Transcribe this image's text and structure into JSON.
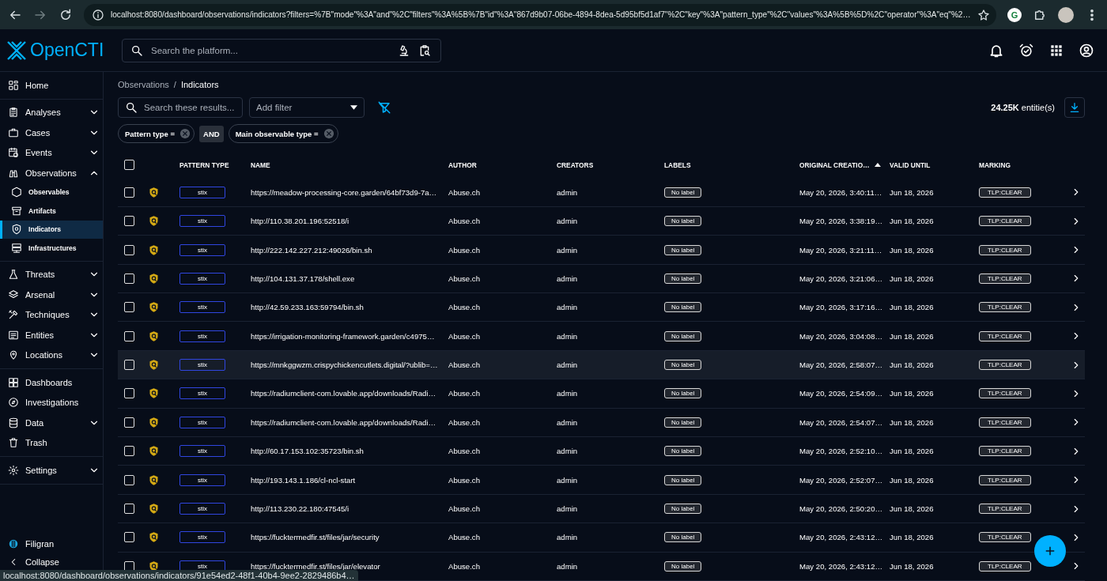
{
  "browser": {
    "url": "localhost:8080/dashboard/observations/indicators?filters=%7B\"mode\"%3A\"and\"%2C\"filters\"%3A%5B%7B\"id\"%3A\"867d9b07-06be-4894-8dea-5d95bf5d1af7\"%2C\"key\"%3A\"pattern_type\"%2C\"values\"%3A%5B%5D%2C\"operator\"%3A\"eq\"%2…",
    "extension_letter": "G",
    "status_url": "localhost:8080/dashboard/observations/indicators/91e54ed2-48f1-40b4-9ee2-2829486b4…"
  },
  "header": {
    "logo": "OpenCTI",
    "search": {
      "placeholder": "Search the platform..."
    }
  },
  "sidebar": {
    "groups": [
      [
        {
          "label": "Home",
          "selected": false
        }
      ],
      [
        {
          "label": "Analyses",
          "selected": false,
          "expanded": false
        },
        {
          "label": "Cases",
          "selected": false,
          "expanded": false
        },
        {
          "label": "Events",
          "selected": false,
          "expanded": false
        },
        {
          "label": "Observations",
          "selected": false,
          "expanded": true,
          "children": [
            {
              "label": "Observables",
              "selected": false
            },
            {
              "label": "Artifacts",
              "selected": false
            },
            {
              "label": "Indicators",
              "selected": true
            },
            {
              "label": "Infrastructures",
              "selected": false
            }
          ]
        }
      ],
      [
        {
          "label": "Threats",
          "selected": false,
          "expanded": false
        },
        {
          "label": "Arsenal",
          "selected": false,
          "expanded": false
        },
        {
          "label": "Techniques",
          "selected": false,
          "expanded": false
        },
        {
          "label": "Entities",
          "selected": false,
          "expanded": false
        },
        {
          "label": "Locations",
          "selected": false,
          "expanded": false
        }
      ],
      [
        {
          "label": "Dashboards",
          "selected": false
        },
        {
          "label": "Investigations",
          "selected": false
        },
        {
          "label": "Data",
          "selected": false,
          "expanded": false
        },
        {
          "label": "Trash",
          "selected": false
        }
      ],
      [
        {
          "label": "Settings",
          "selected": false,
          "expanded": false
        }
      ]
    ],
    "brand": "Filigran",
    "collapse": "Collapse"
  },
  "breadcrumbs": [
    "Observations",
    "Indicators"
  ],
  "breadcrumb_separator": "/",
  "toolbar": {
    "search": {
      "placeholder": "Search these results..."
    },
    "filter": {
      "placeholder": "Add filter"
    },
    "count": "**24.25K** entitie(s)"
  },
  "filters": {
    "chips": [
      {
        "label": "Pattern type ="
      },
      {
        "label": "Main observable type ="
      }
    ],
    "operator": "AND"
  },
  "table": {
    "header_checked": false,
    "columns": [
      {
        "label": "PATTERN TYPE",
        "sorted": false
      },
      {
        "label": "NAME",
        "sorted": false
      },
      {
        "label": "AUTHOR",
        "sorted": false
      },
      {
        "label": "CREATORS",
        "sorted": false
      },
      {
        "label": "LABELS",
        "sorted": false
      },
      {
        "label": "ORIGINAL CREATIO…",
        "sorted": true
      },
      {
        "label": "VALID UNTIL",
        "sorted": false
      },
      {
        "label": "MARKING",
        "sorted": false
      }
    ],
    "rows": [
      {
        "checked": false,
        "highlighted": false,
        "pattern_type": "stix",
        "name": "https://meadow-processing-core.garden/64bf73d9-7a…",
        "author": "Abuse.ch",
        "creators": "admin",
        "labels": "No label",
        "original_creation": "May 20, 2026, 3:40:11…",
        "valid_until": "Jun 18, 2026",
        "marking": "TLP:CLEAR"
      },
      {
        "checked": false,
        "highlighted": false,
        "pattern_type": "stix",
        "name": "http://110.38.201.196:52518/i",
        "author": "Abuse.ch",
        "creators": "admin",
        "labels": "No label",
        "original_creation": "May 20, 2026, 3:38:19…",
        "valid_until": "Jun 18, 2026",
        "marking": "TLP:CLEAR"
      },
      {
        "checked": false,
        "highlighted": false,
        "pattern_type": "stix",
        "name": "http://222.142.227.212:49026/bin.sh",
        "author": "Abuse.ch",
        "creators": "admin",
        "labels": "No label",
        "original_creation": "May 20, 2026, 3:21:11…",
        "valid_until": "Jun 18, 2026",
        "marking": "TLP:CLEAR"
      },
      {
        "checked": false,
        "highlighted": false,
        "pattern_type": "stix",
        "name": "http://104.131.37.178/shell.exe",
        "author": "Abuse.ch",
        "creators": "admin",
        "labels": "No label",
        "original_creation": "May 20, 2026, 3:21:06…",
        "valid_until": "Jun 18, 2026",
        "marking": "TLP:CLEAR"
      },
      {
        "checked": false,
        "highlighted": false,
        "pattern_type": "stix",
        "name": "http://42.59.233.163:59794/bin.sh",
        "author": "Abuse.ch",
        "creators": "admin",
        "labels": "No label",
        "original_creation": "May 20, 2026, 3:17:16…",
        "valid_until": "Jun 18, 2026",
        "marking": "TLP:CLEAR"
      },
      {
        "checked": false,
        "highlighted": false,
        "pattern_type": "stix",
        "name": "https://irrigation-monitoring-framework.garden/c4975…",
        "author": "Abuse.ch",
        "creators": "admin",
        "labels": "No label",
        "original_creation": "May 20, 2026, 3:04:08…",
        "valid_until": "Jun 18, 2026",
        "marking": "TLP:CLEAR"
      },
      {
        "checked": false,
        "highlighted": true,
        "pattern_type": "stix",
        "name": "https://mnkggwzm.crispychickencutlets.digital/?ublib=…",
        "author": "Abuse.ch",
        "creators": "admin",
        "labels": "No label",
        "original_creation": "May 20, 2026, 2:58:07…",
        "valid_until": "Jun 18, 2026",
        "marking": "TLP:CLEAR"
      },
      {
        "checked": false,
        "highlighted": false,
        "pattern_type": "stix",
        "name": "https://radiumclient-com.lovable.app/downloads/Radi…",
        "author": "Abuse.ch",
        "creators": "admin",
        "labels": "No label",
        "original_creation": "May 20, 2026, 2:54:09…",
        "valid_until": "Jun 18, 2026",
        "marking": "TLP:CLEAR"
      },
      {
        "checked": false,
        "highlighted": false,
        "pattern_type": "stix",
        "name": "https://radiumclient-com.lovable.app/downloads/Radi…",
        "author": "Abuse.ch",
        "creators": "admin",
        "labels": "No label",
        "original_creation": "May 20, 2026, 2:54:07…",
        "valid_until": "Jun 18, 2026",
        "marking": "TLP:CLEAR"
      },
      {
        "checked": false,
        "highlighted": false,
        "pattern_type": "stix",
        "name": "http://60.17.153.102:35723/bin.sh",
        "author": "Abuse.ch",
        "creators": "admin",
        "labels": "No label",
        "original_creation": "May 20, 2026, 2:52:10…",
        "valid_until": "Jun 18, 2026",
        "marking": "TLP:CLEAR"
      },
      {
        "checked": false,
        "highlighted": false,
        "pattern_type": "stix",
        "name": "http://193.143.1.186/cl-ncl-start",
        "author": "Abuse.ch",
        "creators": "admin",
        "labels": "No label",
        "original_creation": "May 20, 2026, 2:52:07…",
        "valid_until": "Jun 18, 2026",
        "marking": "TLP:CLEAR"
      },
      {
        "checked": false,
        "highlighted": false,
        "pattern_type": "stix",
        "name": "http://113.230.22.180:47545/i",
        "author": "Abuse.ch",
        "creators": "admin",
        "labels": "No label",
        "original_creation": "May 20, 2026, 2:50:20…",
        "valid_until": "Jun 18, 2026",
        "marking": "TLP:CLEAR"
      },
      {
        "checked": false,
        "highlighted": false,
        "pattern_type": "stix",
        "name": "https://fucktermedfir.st/files/jar/security",
        "author": "Abuse.ch",
        "creators": "admin",
        "labels": "No label",
        "original_creation": "May 20, 2026, 2:43:12…",
        "valid_until": "Jun 18, 2026",
        "marking": "TLP:CLEAR"
      },
      {
        "checked": false,
        "highlighted": false,
        "pattern_type": "stix",
        "name": "https://fucktermedfir.st/files/jar/elevator",
        "author": "Abuse.ch",
        "creators": "admin",
        "labels": "No label",
        "original_creation": "May 20, 2026, 2:43:12…",
        "valid_until": "Jun 18, 2026",
        "marking": "TLP:CLEAR"
      }
    ]
  }
}
